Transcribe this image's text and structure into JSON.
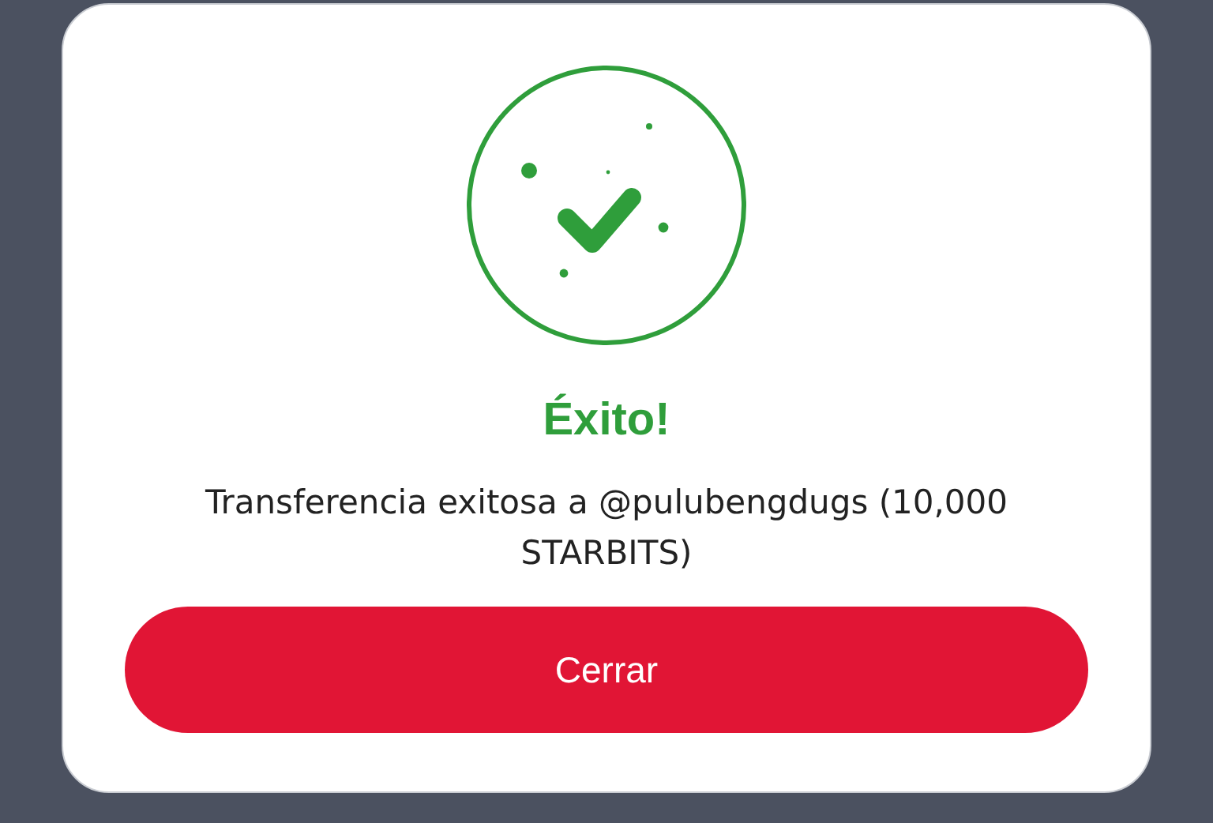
{
  "dialog": {
    "title": "Éxito!",
    "message": "Transferencia exitosa a @pulubengdugs (10,000 STARBITS)",
    "buttons": [
      "Cerrar"
    ]
  }
}
